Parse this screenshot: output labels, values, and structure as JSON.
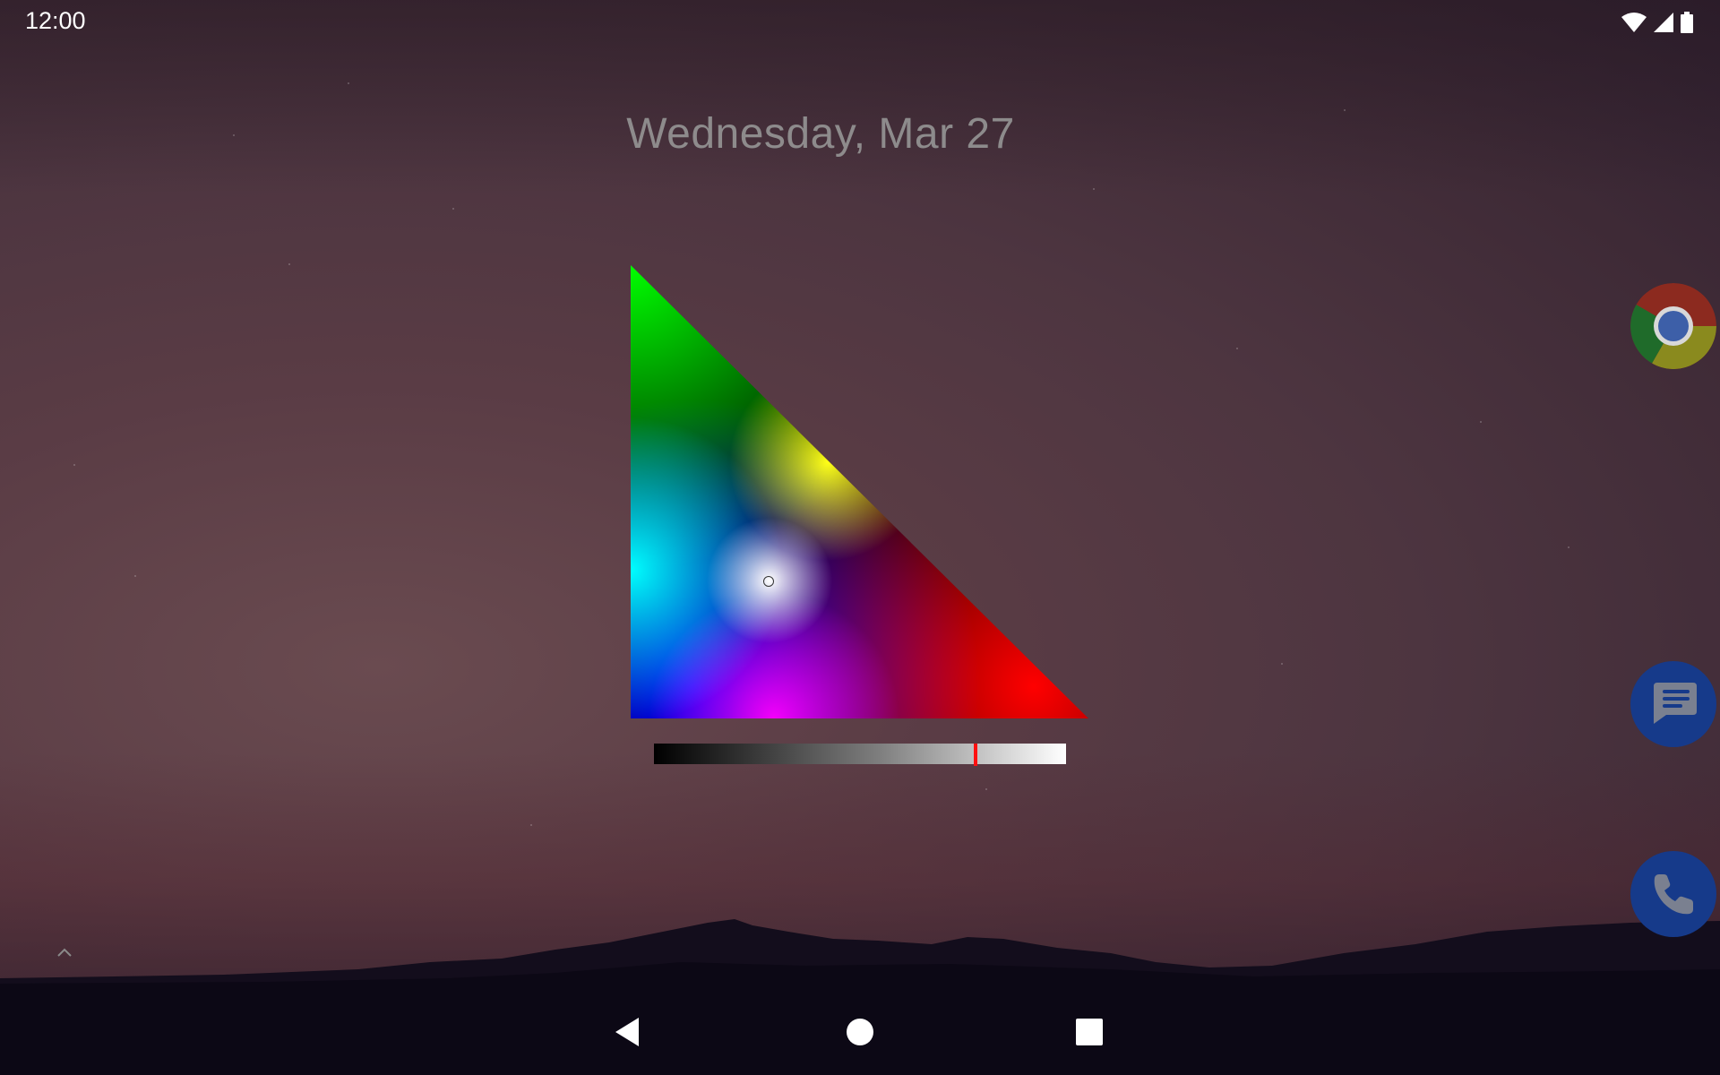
{
  "status_bar": {
    "time": "12:00",
    "icons": [
      "wifi-icon",
      "cellular-signal-icon",
      "battery-icon"
    ]
  },
  "lockscreen": {
    "date": "Wednesday, Mar 27"
  },
  "color_picker": {
    "vertex_colors": {
      "top": "#00ff00",
      "bottom_left": "#0000ff",
      "bottom_right": "#ff0000"
    },
    "selected_color_preview": "#ffffff",
    "brightness_level_percent": 78,
    "slider_thumb_color": "#ff1010"
  },
  "shortcuts": [
    {
      "name": "Chrome",
      "icon": "chrome-icon"
    },
    {
      "name": "Messages",
      "icon": "messages-icon",
      "color": "#163a8a"
    },
    {
      "name": "Phone",
      "icon": "phone-icon",
      "color": "#163a8a"
    }
  ],
  "navigation": {
    "buttons": [
      "back-icon",
      "home-icon",
      "recents-icon"
    ]
  }
}
